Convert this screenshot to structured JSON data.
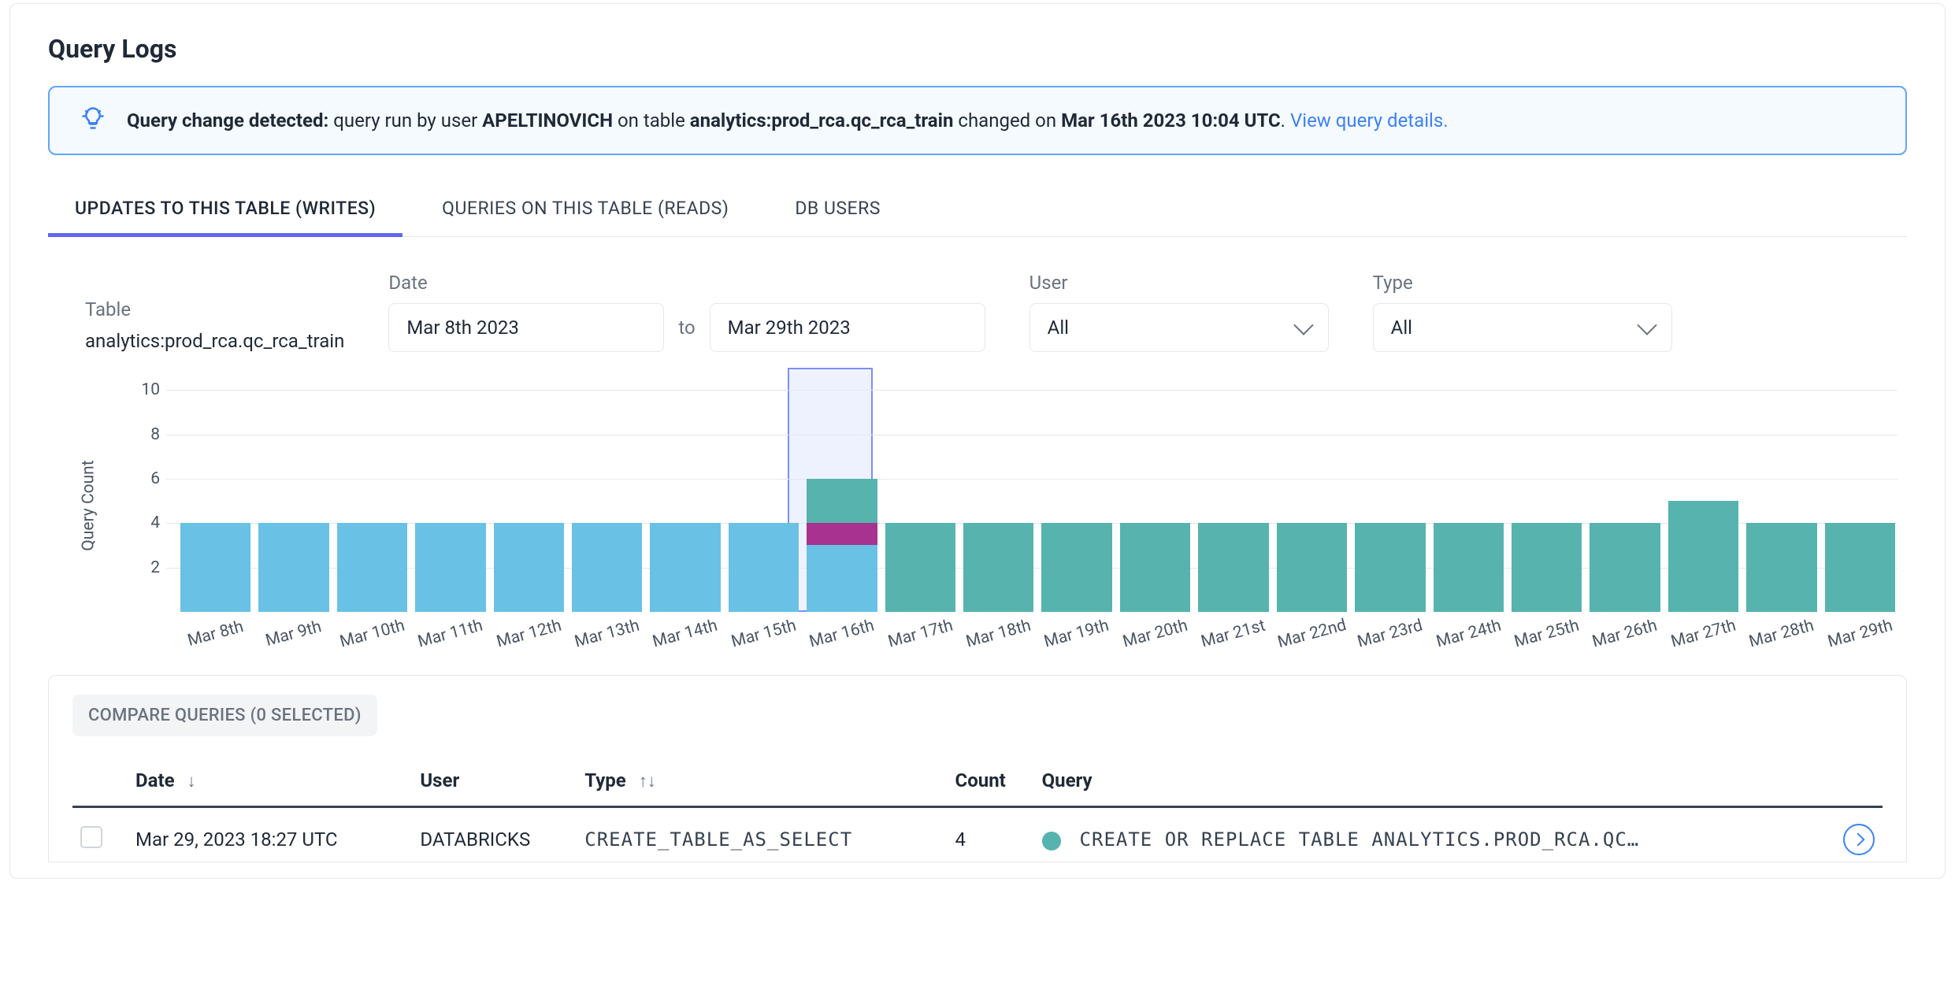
{
  "page_title": "Query Logs",
  "banner": {
    "prefix": "Query change detected:",
    "middle_1": " query run by user ",
    "user": "APELTINOVICH",
    "middle_2": " on table ",
    "table": "analytics:prod_rca.qc_rca_train",
    "middle_3": " changed on ",
    "date": "Mar 16th 2023 10:04 UTC",
    "suffix": ". ",
    "link_text": "View query details."
  },
  "tabs": [
    {
      "label": "UPDATES TO THIS TABLE (WRITES)",
      "active": true
    },
    {
      "label": "QUERIES ON THIS TABLE (READS)",
      "active": false
    },
    {
      "label": "DB USERS",
      "active": false
    }
  ],
  "filters": {
    "table_label": "Table",
    "table_value": "analytics:prod_rca.qc_rca_train",
    "date_label": "Date",
    "date_from": "Mar 8th 2023",
    "date_to_label": "to",
    "date_to": "Mar 29th 2023",
    "user_label": "User",
    "user_value": "All",
    "type_label": "Type",
    "type_value": "All"
  },
  "chart_data": {
    "type": "bar",
    "ylabel": "Query Count",
    "ylim": [
      0,
      11
    ],
    "yticks": [
      2,
      4,
      6,
      8,
      10
    ],
    "highlight_category": "Mar 16th",
    "highlight_height": 11,
    "categories": [
      "Mar 8th",
      "Mar 9th",
      "Mar 10th",
      "Mar 11th",
      "Mar 12th",
      "Mar 13th",
      "Mar 14th",
      "Mar 15th",
      "Mar 16th",
      "Mar 17th",
      "Mar 18th",
      "Mar 19th",
      "Mar 20th",
      "Mar 21st",
      "Mar 22nd",
      "Mar 23rd",
      "Mar 24th",
      "Mar 25th",
      "Mar 26th",
      "Mar 27th",
      "Mar 28th",
      "Mar 29th"
    ],
    "series_order": [
      "sky",
      "purple",
      "teal"
    ],
    "series_colors": {
      "sky": "#69c1e6",
      "purple": "#a8328f",
      "teal": "#56b3ae"
    },
    "stacks": [
      {
        "sky": 4,
        "purple": 0,
        "teal": 0
      },
      {
        "sky": 4,
        "purple": 0,
        "teal": 0
      },
      {
        "sky": 4,
        "purple": 0,
        "teal": 0
      },
      {
        "sky": 4,
        "purple": 0,
        "teal": 0
      },
      {
        "sky": 4,
        "purple": 0,
        "teal": 0
      },
      {
        "sky": 4,
        "purple": 0,
        "teal": 0
      },
      {
        "sky": 4,
        "purple": 0,
        "teal": 0
      },
      {
        "sky": 4,
        "purple": 0,
        "teal": 0
      },
      {
        "sky": 3,
        "purple": 1,
        "teal": 2
      },
      {
        "sky": 0,
        "purple": 0,
        "teal": 4
      },
      {
        "sky": 0,
        "purple": 0,
        "teal": 4
      },
      {
        "sky": 0,
        "purple": 0,
        "teal": 4
      },
      {
        "sky": 0,
        "purple": 0,
        "teal": 4
      },
      {
        "sky": 0,
        "purple": 0,
        "teal": 4
      },
      {
        "sky": 0,
        "purple": 0,
        "teal": 4
      },
      {
        "sky": 0,
        "purple": 0,
        "teal": 4
      },
      {
        "sky": 0,
        "purple": 0,
        "teal": 4
      },
      {
        "sky": 0,
        "purple": 0,
        "teal": 4
      },
      {
        "sky": 0,
        "purple": 0,
        "teal": 4
      },
      {
        "sky": 0,
        "purple": 0,
        "teal": 5
      },
      {
        "sky": 0,
        "purple": 0,
        "teal": 4
      },
      {
        "sky": 0,
        "purple": 0,
        "teal": 4
      }
    ]
  },
  "table": {
    "compare_label": "COMPARE QUERIES (0 SELECTED)",
    "columns": {
      "date": "Date",
      "user": "User",
      "type": "Type",
      "count": "Count",
      "query": "Query"
    },
    "rows": [
      {
        "date": "Mar 29, 2023 18:27 UTC",
        "user": "DATABRICKS",
        "type": "CREATE_TABLE_AS_SELECT",
        "count": "4",
        "query": "CREATE OR REPLACE TABLE ANALYTICS.PROD_RCA.QC…"
      }
    ]
  }
}
